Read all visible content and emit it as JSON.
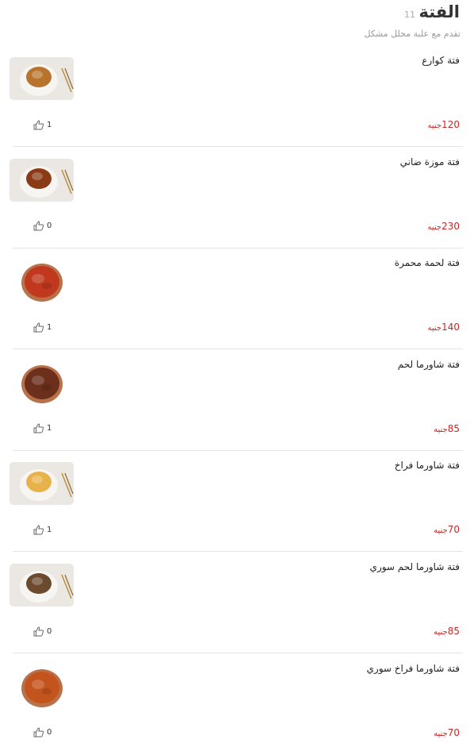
{
  "category": {
    "title": "الفتة",
    "count": "11",
    "subtitle": "تقدم مع علبة مخلل مشكل"
  },
  "currency": "جنيه",
  "items": [
    {
      "name": "فتة كوارع",
      "price": "120",
      "likes": "1",
      "thumb_style": "framed",
      "dish_color": "#b8742c"
    },
    {
      "name": "فتة موزة ضاني",
      "price": "230",
      "likes": "0",
      "thumb_style": "framed",
      "dish_color": "#8a3a15"
    },
    {
      "name": "فتة لحمة محمرة",
      "price": "140",
      "likes": "1",
      "thumb_style": "bowl",
      "dish_color": "#c0391e"
    },
    {
      "name": "فتة شاورما لحم",
      "price": "85",
      "likes": "1",
      "thumb_style": "bowl",
      "dish_color": "#6b2f1c"
    },
    {
      "name": "فتة شاورما فراخ",
      "price": "70",
      "likes": "1",
      "thumb_style": "framed",
      "dish_color": "#e8b24a"
    },
    {
      "name": "فتة شاورما لحم سوري",
      "price": "85",
      "likes": "0",
      "thumb_style": "framed",
      "dish_color": "#6b4a2e"
    },
    {
      "name": "فتة شاورما فراخ سوري",
      "price": "70",
      "likes": "0",
      "thumb_style": "bowl",
      "dish_color": "#c4541e"
    }
  ]
}
